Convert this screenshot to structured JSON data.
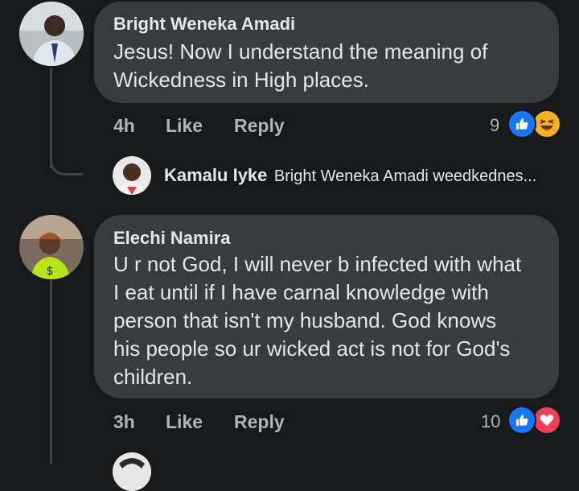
{
  "comments": [
    {
      "author": "Bright Weneka Amadi",
      "text_lines": [
        "Jesus! Now I understand the meaning of",
        "Wickedness in High places."
      ],
      "time": "4h",
      "like_label": "Like",
      "reply_label": "Reply",
      "reaction_count": "9",
      "reactions": [
        "like-icon",
        "haha-icon"
      ]
    },
    {
      "author": "Elechi Namira",
      "text_lines": [
        "U r not God, I will never b infected with what",
        "I eat until if I have carnal knowledge with",
        "person that isn't my husband. God knows",
        "his people so ur wicked act is not for God's",
        "children."
      ],
      "time": "3h",
      "like_label": "Like",
      "reply_label": "Reply",
      "reaction_count": "10",
      "reactions": [
        "like-icon",
        "love-icon"
      ]
    }
  ],
  "reply_preview": {
    "author": "Kamalu Iyke",
    "snippet": "Bright Weneka Amadi weedkednes..."
  },
  "colors": {
    "background": "#18191a",
    "bubble": "#3a3b3c",
    "like_blue": "#1877f2",
    "love_red": "#f33e58",
    "haha_yellow": "#f7b125"
  }
}
